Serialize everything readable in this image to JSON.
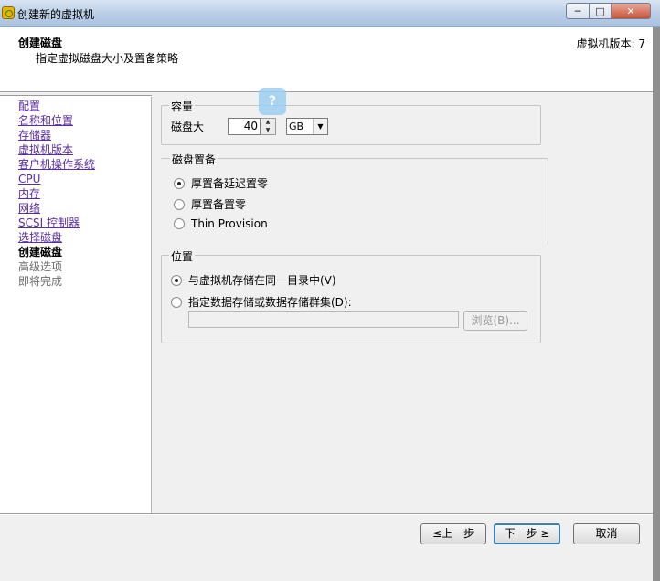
{
  "window": {
    "title": "创建新的虚拟机",
    "minimize": "─",
    "maximize": "□",
    "close": "✕"
  },
  "header": {
    "title": "创建磁盘",
    "subtitle": "指定虚拟磁盘大小及置备策略",
    "version": "虚拟机版本: 7"
  },
  "nav": {
    "items": [
      {
        "label": "配置",
        "state": "link"
      },
      {
        "label": "名称和位置",
        "state": "link"
      },
      {
        "label": "存储器",
        "state": "link"
      },
      {
        "label": "虚拟机版本",
        "state": "link"
      },
      {
        "label": "客户机操作系统",
        "state": "link"
      },
      {
        "label": "CPU",
        "state": "link"
      },
      {
        "label": "内存",
        "state": "link"
      },
      {
        "label": "网络",
        "state": "link"
      },
      {
        "label": "SCSI 控制器",
        "state": "link"
      },
      {
        "label": "选择磁盘",
        "state": "link"
      },
      {
        "label": "创建磁盘",
        "state": "current"
      },
      {
        "label": "高级选项",
        "state": "disabled"
      },
      {
        "label": "即将完成",
        "state": "disabled"
      }
    ]
  },
  "capacity": {
    "legend": "容量",
    "disk_size_label": "磁盘大",
    "disk_size_value": "40",
    "unit_selected": "GB"
  },
  "provisioning": {
    "legend": "磁盘置备",
    "options": [
      {
        "label": "厚置备延迟置零",
        "selected": true
      },
      {
        "label": "厚置备置零",
        "selected": false
      },
      {
        "label": "Thin Provision",
        "selected": false
      }
    ]
  },
  "location": {
    "legend": "位置",
    "option_same_dir": "与虚拟机存储在同一目录中(V)",
    "option_specify": "指定数据存储或数据存储群集(D):",
    "path_value": "",
    "browse_label": "浏览(B)..."
  },
  "footer": {
    "back_label": "≤上一步",
    "next_label": "下一步 ≥",
    "cancel_label": "取消"
  }
}
